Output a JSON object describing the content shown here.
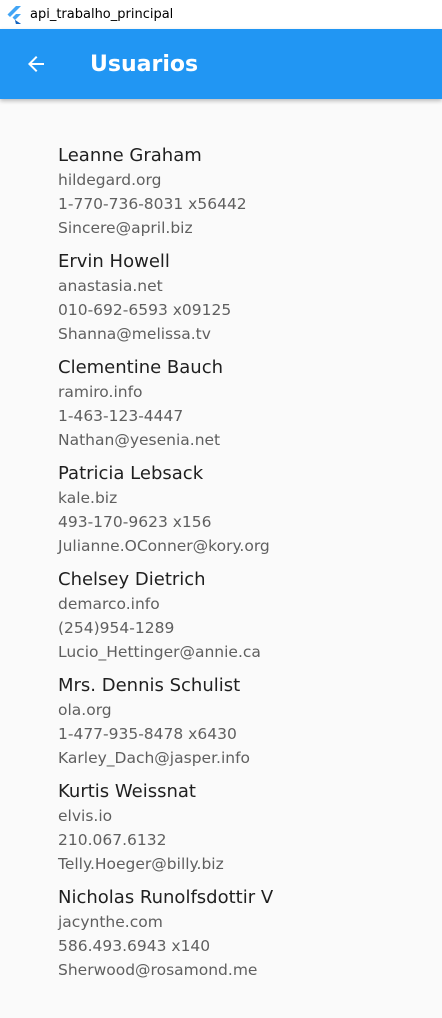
{
  "window": {
    "title": "api_trabalho_principal"
  },
  "appbar": {
    "title": "Usuarios",
    "color": "#2196f3"
  },
  "users": [
    {
      "name": "Leanne Graham",
      "website": "hildegard.org",
      "phone": "1-770-736-8031 x56442",
      "email": "Sincere@april.biz"
    },
    {
      "name": "Ervin Howell",
      "website": "anastasia.net",
      "phone": "010-692-6593 x09125",
      "email": "Shanna@melissa.tv"
    },
    {
      "name": "Clementine Bauch",
      "website": "ramiro.info",
      "phone": "1-463-123-4447",
      "email": "Nathan@yesenia.net"
    },
    {
      "name": "Patricia Lebsack",
      "website": "kale.biz",
      "phone": "493-170-9623 x156",
      "email": "Julianne.OConner@kory.org"
    },
    {
      "name": "Chelsey Dietrich",
      "website": "demarco.info",
      "phone": "(254)954-1289",
      "email": "Lucio_Hettinger@annie.ca"
    },
    {
      "name": "Mrs. Dennis Schulist",
      "website": "ola.org",
      "phone": "1-477-935-8478 x6430",
      "email": "Karley_Dach@jasper.info"
    },
    {
      "name": "Kurtis Weissnat",
      "website": "elvis.io",
      "phone": "210.067.6132",
      "email": "Telly.Hoeger@billy.biz"
    },
    {
      "name": "Nicholas Runolfsdottir V",
      "website": "jacynthe.com",
      "phone": "586.493.6943 x140",
      "email": "Sherwood@rosamond.me"
    }
  ]
}
